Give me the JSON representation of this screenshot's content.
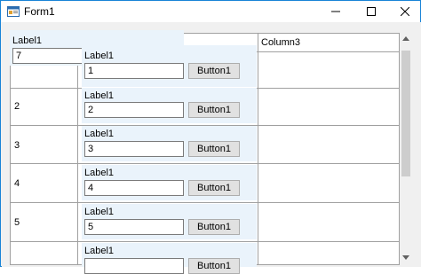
{
  "window": {
    "title": "Form1",
    "controls": {
      "minimize_icon": "minimize-icon",
      "maximize_icon": "maximize-icon",
      "close_icon": "close-icon"
    }
  },
  "grid": {
    "columns": [
      "Column3"
    ],
    "rows": [
      {
        "row_label": "",
        "label": "Label1",
        "value": "1",
        "button": "Button1"
      },
      {
        "row_label": "2",
        "label": "Label1",
        "value": "2",
        "button": "Button1"
      },
      {
        "row_label": "3",
        "label": "Label1",
        "value": "3",
        "button": "Button1"
      },
      {
        "row_label": "4",
        "label": "Label1",
        "value": "4",
        "button": "Button1"
      },
      {
        "row_label": "5",
        "label": "Label1",
        "value": "5",
        "button": "Button1"
      },
      {
        "row_label": "",
        "label": "Label1",
        "value": "",
        "button": "Button1"
      }
    ]
  },
  "top_panel": {
    "label": "Label1",
    "value": "7"
  },
  "colors": {
    "titlebar": "#ffffff",
    "window_border": "#1883d7",
    "panel_bg": "#eaf3fb",
    "grid_line": "#a0a0a0"
  }
}
